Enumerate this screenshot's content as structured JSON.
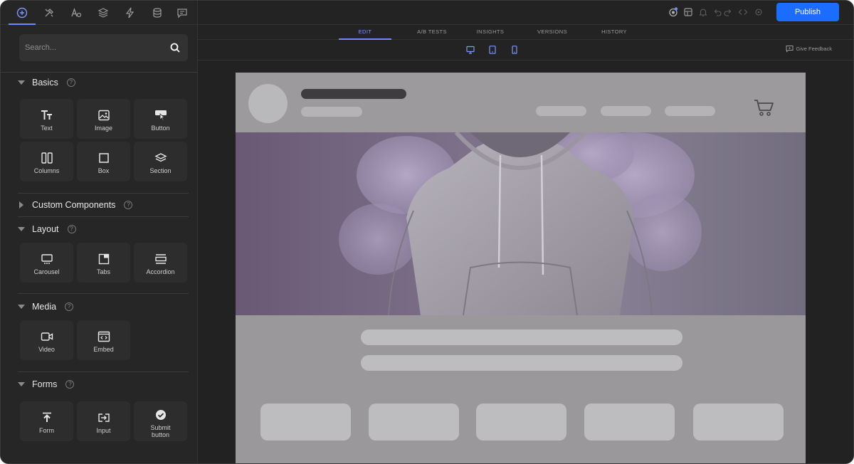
{
  "sidebar": {
    "tool_tabs": [
      {
        "icon": "add-circle-icon",
        "active": true
      },
      {
        "icon": "tools-icon"
      },
      {
        "icon": "typography-icon"
      },
      {
        "icon": "layers-icon"
      },
      {
        "icon": "lightning-icon"
      },
      {
        "icon": "database-icon"
      },
      {
        "icon": "comment-icon"
      }
    ],
    "search": {
      "placeholder": "Search..."
    },
    "sections": {
      "basics": {
        "title": "Basics",
        "items": [
          {
            "label": "Text",
            "icon": "text-icon"
          },
          {
            "label": "Image",
            "icon": "image-icon"
          },
          {
            "label": "Button",
            "icon": "button-icon"
          },
          {
            "label": "Columns",
            "icon": "columns-icon"
          },
          {
            "label": "Box",
            "icon": "box-icon"
          },
          {
            "label": "Section",
            "icon": "section-icon"
          }
        ]
      },
      "custom": {
        "title": "Custom Components",
        "collapsed": true
      },
      "layout": {
        "title": "Layout",
        "items": [
          {
            "label": "Carousel",
            "icon": "carousel-icon"
          },
          {
            "label": "Tabs",
            "icon": "tabs-icon"
          },
          {
            "label": "Accordion",
            "icon": "accordion-icon"
          }
        ]
      },
      "media": {
        "title": "Media",
        "items": [
          {
            "label": "Video",
            "icon": "video-icon"
          },
          {
            "label": "Embed",
            "icon": "embed-icon"
          }
        ]
      },
      "forms": {
        "title": "Forms",
        "items": [
          {
            "label": "Form",
            "icon": "form-icon"
          },
          {
            "label": "Input",
            "icon": "input-icon"
          },
          {
            "label": "Submit button",
            "icon": "check-circle-icon"
          }
        ]
      }
    }
  },
  "topbar": {
    "publish_label": "Publish",
    "icons": [
      "badge-icon",
      "page-settings-icon",
      "bell-icon",
      "undo-icon",
      "redo-icon",
      "code-icon",
      "preview-icon"
    ]
  },
  "mode_tabs": [
    {
      "label": "EDIT",
      "active": true
    },
    {
      "label": "A/B TESTS"
    },
    {
      "label": "INSIGHTS"
    },
    {
      "label": "VERSIONS"
    },
    {
      "label": "HISTORY"
    }
  ],
  "devices": [
    "desktop-icon",
    "tablet-icon",
    "mobile-icon"
  ],
  "feedback_label": "Give Feedback",
  "colors": {
    "accent": "#6b8cff",
    "publish": "#1a6dff",
    "panel": "#262626",
    "canvas_page": "#9a989b"
  }
}
